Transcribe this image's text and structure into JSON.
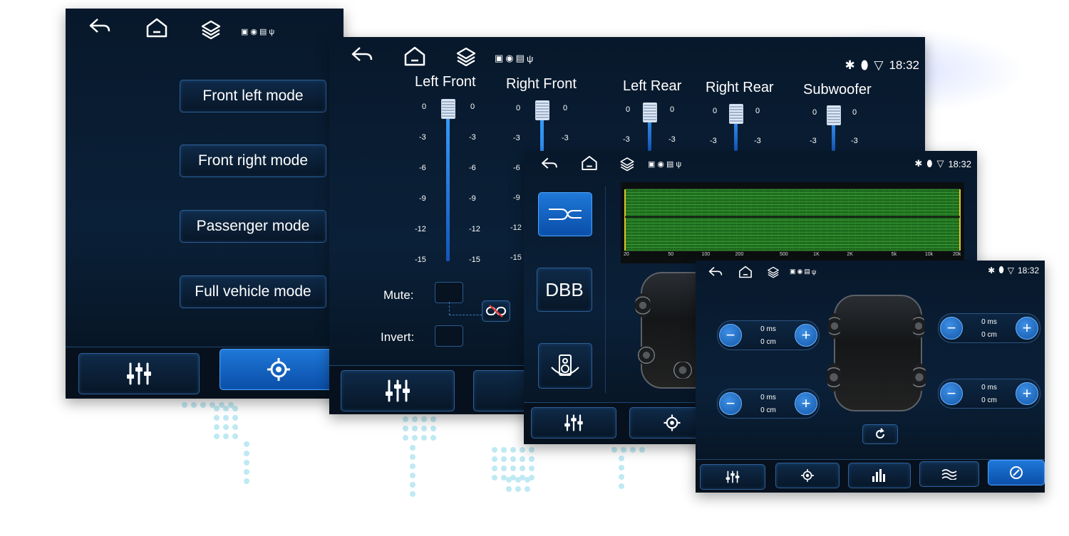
{
  "icons": {
    "back": "back-icon",
    "home": "home-icon",
    "layers": "layers-icon",
    "photo": "photo-icon",
    "disc": "disc-icon",
    "radio": "radio-icon",
    "usb": "usb-icon",
    "bluetooth": "bluetooth-icon",
    "location": "location-icon",
    "wifi": "wifi-icon"
  },
  "colors": {
    "accent": "#1f78d8",
    "panel": "#0a2038",
    "eqGrid": "#46b341",
    "eqLine": "#e0c32a"
  },
  "screen1": {
    "modes": [
      "Front left mode",
      "Front right mode",
      "Passenger mode",
      "Full vehicle mode"
    ]
  },
  "screen2": {
    "channels": [
      "Left Front",
      "Right Front",
      "Left Rear",
      "Right Rear",
      "Subwoofer"
    ],
    "scale": [
      "0",
      "-3",
      "-6",
      "-9",
      "-12",
      "-15"
    ],
    "mute_label": "Mute:",
    "invert_label": "Invert:",
    "time": "18:32"
  },
  "screen3": {
    "time": "18:32",
    "dbb_label": "DBB",
    "eq_freqs": [
      "20",
      "50",
      "100",
      "200",
      "500",
      "1K",
      "2K",
      "5k",
      "10k",
      "20k"
    ]
  },
  "screen4": {
    "time": "18:32",
    "delays": [
      {
        "ms": "0 ms",
        "cm": "0 cm"
      },
      {
        "ms": "0 ms",
        "cm": "0 cm"
      },
      {
        "ms": "0 ms",
        "cm": "0 cm"
      },
      {
        "ms": "0 ms",
        "cm": "0 cm"
      }
    ]
  }
}
